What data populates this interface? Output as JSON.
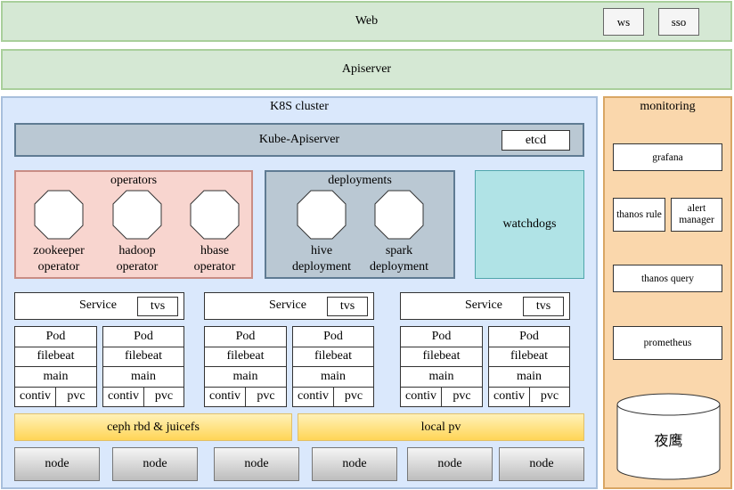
{
  "web": {
    "label": "Web",
    "buttons": [
      {
        "label": "ws"
      },
      {
        "label": "sso"
      }
    ]
  },
  "apiserver": {
    "label": "Apiserver"
  },
  "cluster": {
    "title": "K8S cluster",
    "kube_apiserver": {
      "label": "Kube-Apiserver",
      "etcd": "etcd"
    },
    "operators": {
      "title": "operators",
      "items": [
        {
          "line1": "zookeeper",
          "line2": "operator"
        },
        {
          "line1": "hadoop",
          "line2": "operator"
        },
        {
          "line1": "hbase",
          "line2": "operator"
        }
      ]
    },
    "deployments": {
      "title": "deployments",
      "items": [
        {
          "line1": "hive",
          "line2": "deployment"
        },
        {
          "line1": "spark",
          "line2": "deployment"
        }
      ]
    },
    "watchdogs": {
      "label": "watchdogs"
    },
    "services": [
      {
        "label": "Service",
        "tag": "tvs",
        "pods": [
          {
            "title": "Pod",
            "sidecar": "filebeat",
            "main": "main",
            "left": "contiv",
            "right": "pvc"
          },
          {
            "title": "Pod",
            "sidecar": "filebeat",
            "main": "main",
            "left": "contiv",
            "right": "pvc"
          }
        ]
      },
      {
        "label": "Service",
        "tag": "tvs",
        "pods": [
          {
            "title": "Pod",
            "sidecar": "filebeat",
            "main": "main",
            "left": "contiv",
            "right": "pvc"
          },
          {
            "title": "Pod",
            "sidecar": "filebeat",
            "main": "main",
            "left": "contiv",
            "right": "pvc"
          }
        ]
      },
      {
        "label": "Service",
        "tag": "tvs",
        "pods": [
          {
            "title": "Pod",
            "sidecar": "filebeat",
            "main": "main",
            "left": "contiv",
            "right": "pvc"
          },
          {
            "title": "Pod",
            "sidecar": "filebeat",
            "main": "main",
            "left": "contiv",
            "right": "pvc"
          }
        ]
      }
    ],
    "storage": [
      {
        "label": "ceph rbd & juicefs"
      },
      {
        "label": "local pv"
      }
    ],
    "nodes": [
      {
        "label": "node"
      },
      {
        "label": "node"
      },
      {
        "label": "node"
      },
      {
        "label": "node"
      },
      {
        "label": "node"
      },
      {
        "label": "node"
      }
    ]
  },
  "monitoring": {
    "title": "monitoring",
    "grafana": "grafana",
    "thanos_rule": "thanos rule",
    "alert_manager": "alert manager",
    "thanos_query": "thanos query",
    "prometheus": "prometheus",
    "database": "夜鹰"
  }
}
